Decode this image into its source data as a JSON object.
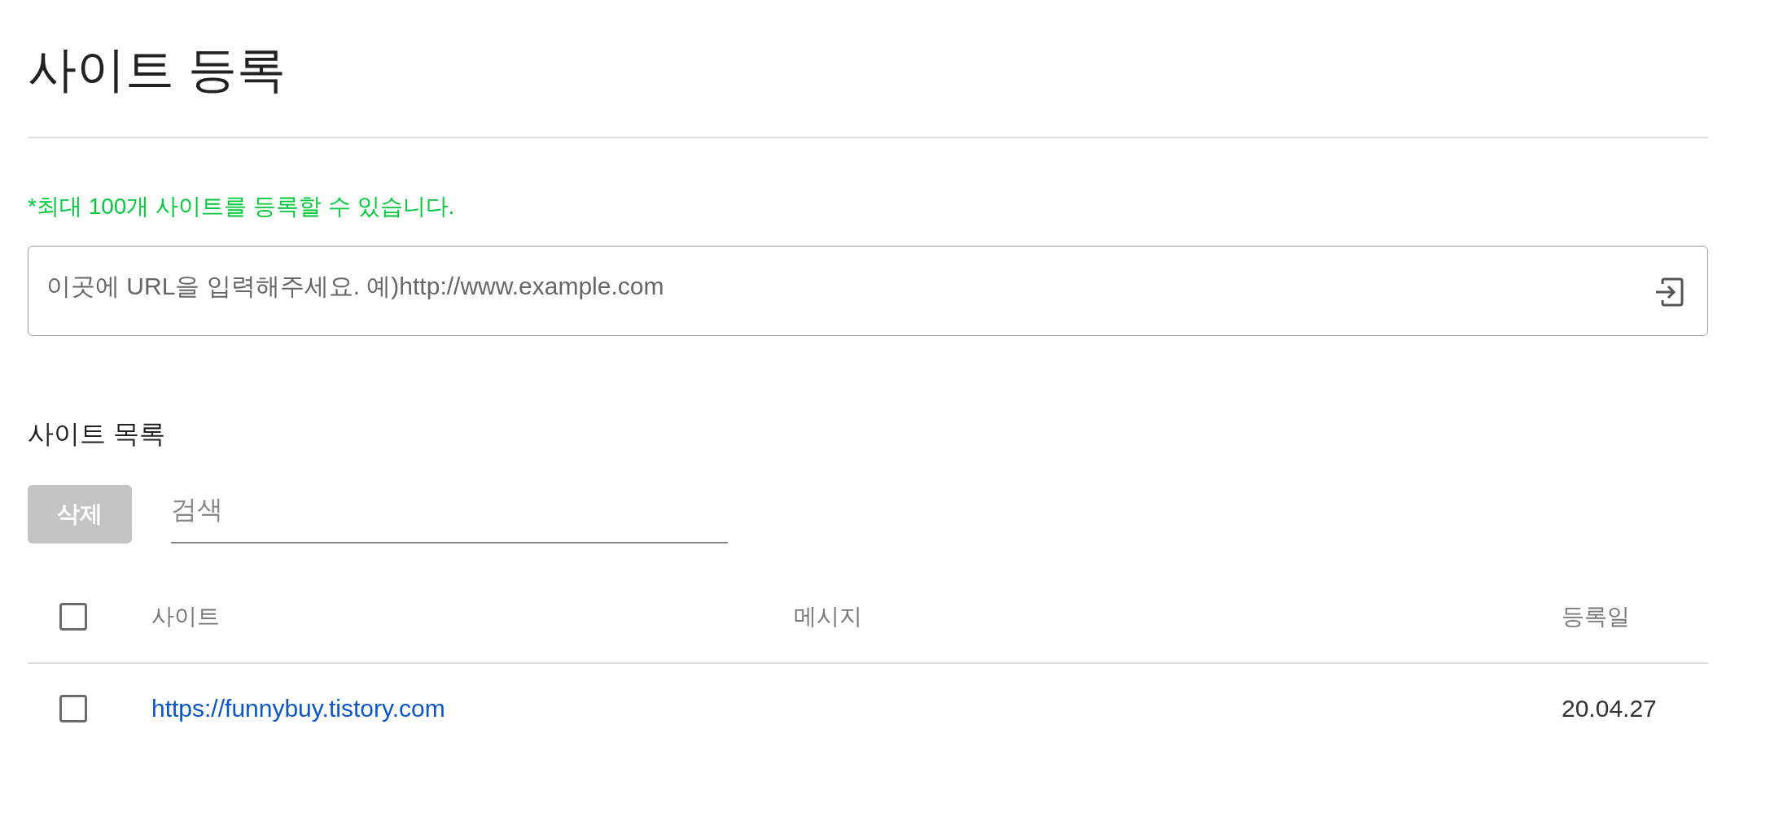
{
  "page": {
    "title": "사이트 등록",
    "notice": "*최대 100개 사이트를 등록할 수 있습니다."
  },
  "url_input": {
    "placeholder": "이곳에 URL을 입력해주세요. 예)http://www.example.com"
  },
  "site_list": {
    "heading": "사이트 목록",
    "delete_button": {
      "label": "삭제",
      "disabled": true
    },
    "search": {
      "placeholder": "검색"
    }
  },
  "table": {
    "select_all": {
      "checked": false
    },
    "columns": [
      "사이트",
      "메시지",
      "등록일"
    ],
    "rows": [
      {
        "checked": false,
        "site": "https://funnybuy.tistory.com",
        "date": "20.04.27"
      }
    ]
  }
}
